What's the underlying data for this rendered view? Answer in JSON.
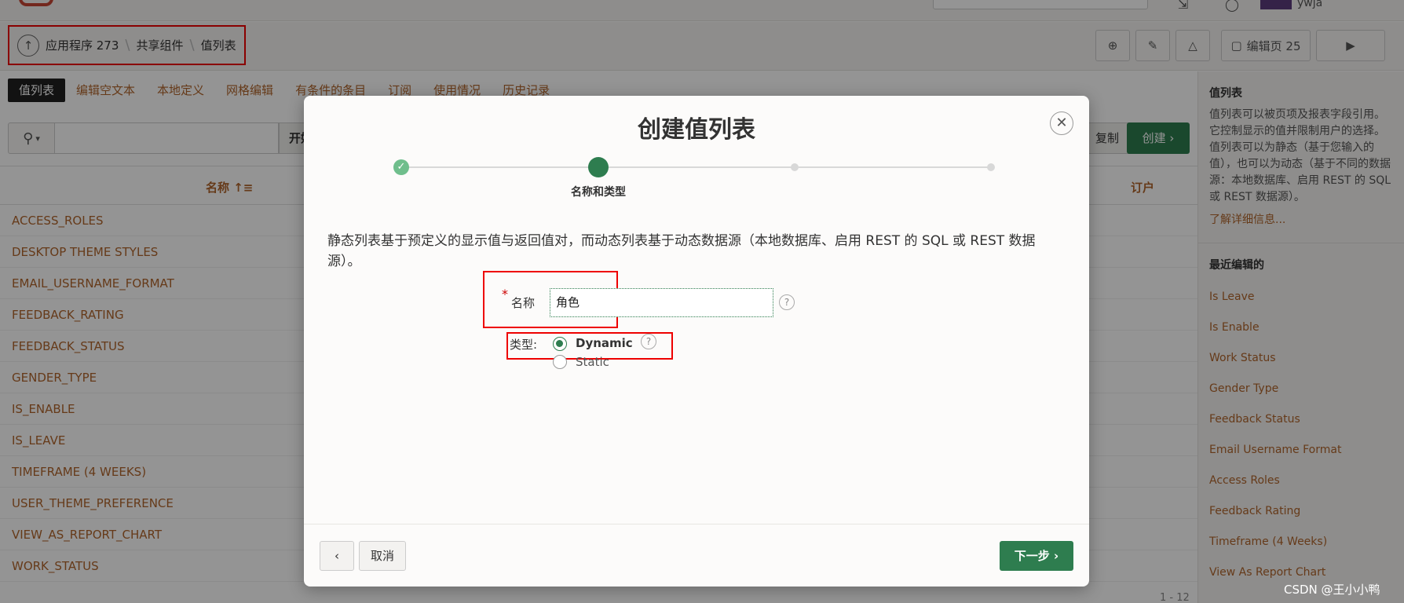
{
  "topbar": {
    "user_name": "ywja"
  },
  "breadcrumb": {
    "items": [
      "应用程序 273",
      "共享组件",
      "值列表"
    ]
  },
  "toolbar": {
    "edit_page_label": "编辑页 25"
  },
  "tabs": [
    {
      "label": "值列表",
      "active": true
    },
    {
      "label": "编辑空文本"
    },
    {
      "label": "本地定义"
    },
    {
      "label": "网格编辑"
    },
    {
      "label": "有条件的条目"
    },
    {
      "label": "订阅"
    },
    {
      "label": "使用情况"
    },
    {
      "label": "历史记录"
    }
  ],
  "filter": {
    "start_label": "开始",
    "copy_label": "复制",
    "create_label": "创建 ›"
  },
  "grid": {
    "headers": {
      "name": "名称 ↑≡",
      "subscribed": "订户"
    },
    "rows": [
      "ACCESS_ROLES",
      "DESKTOP THEME STYLES",
      "EMAIL_USERNAME_FORMAT",
      "FEEDBACK_RATING",
      "FEEDBACK_STATUS",
      "GENDER_TYPE",
      "IS_ENABLE",
      "IS_LEAVE",
      "TIMEFRAME (4 WEEKS)",
      "USER_THEME_PREFERENCE",
      "VIEW_AS_REPORT_CHART",
      "WORK_STATUS"
    ],
    "pagination": "1 - 12"
  },
  "sidebar": {
    "title": "值列表",
    "description": "值列表可以被页项及报表字段引用。它控制显示的值并限制用户的选择。值列表可以为静态（基于您输入的值），也可以为动态（基于不同的数据源：本地数据库、启用 REST 的 SQL 或 REST 数据源）。",
    "learn_more": "了解详细信息...",
    "recent_title": "最近编辑的",
    "recent_items": [
      "Is Leave",
      "Is Enable",
      "Work Status",
      "Gender Type",
      "Feedback Status",
      "Email Username Format",
      "Access Roles",
      "Feedback Rating",
      "Timeframe (4 Weeks)",
      "View As Report Chart"
    ]
  },
  "dialog": {
    "title": "创建值列表",
    "step_label": "名称和类型",
    "intro": "静态列表基于预定义的显示值与返回值对，而动态列表基于动态数据源（本地数据库、启用 REST 的 SQL 或 REST 数据源）。",
    "name_label": "名称",
    "name_value": "角色",
    "type_label": "类型:",
    "type_options": [
      "Dynamic",
      "Static"
    ],
    "type_selected": "Dynamic",
    "cancel_label": "取消",
    "next_label": "下一步 ›"
  },
  "watermark": "CSDN @王小小鸭",
  "colors": {
    "accent": "#2e7d4f",
    "link": "#b0652c",
    "highlight": "#ee0000"
  }
}
